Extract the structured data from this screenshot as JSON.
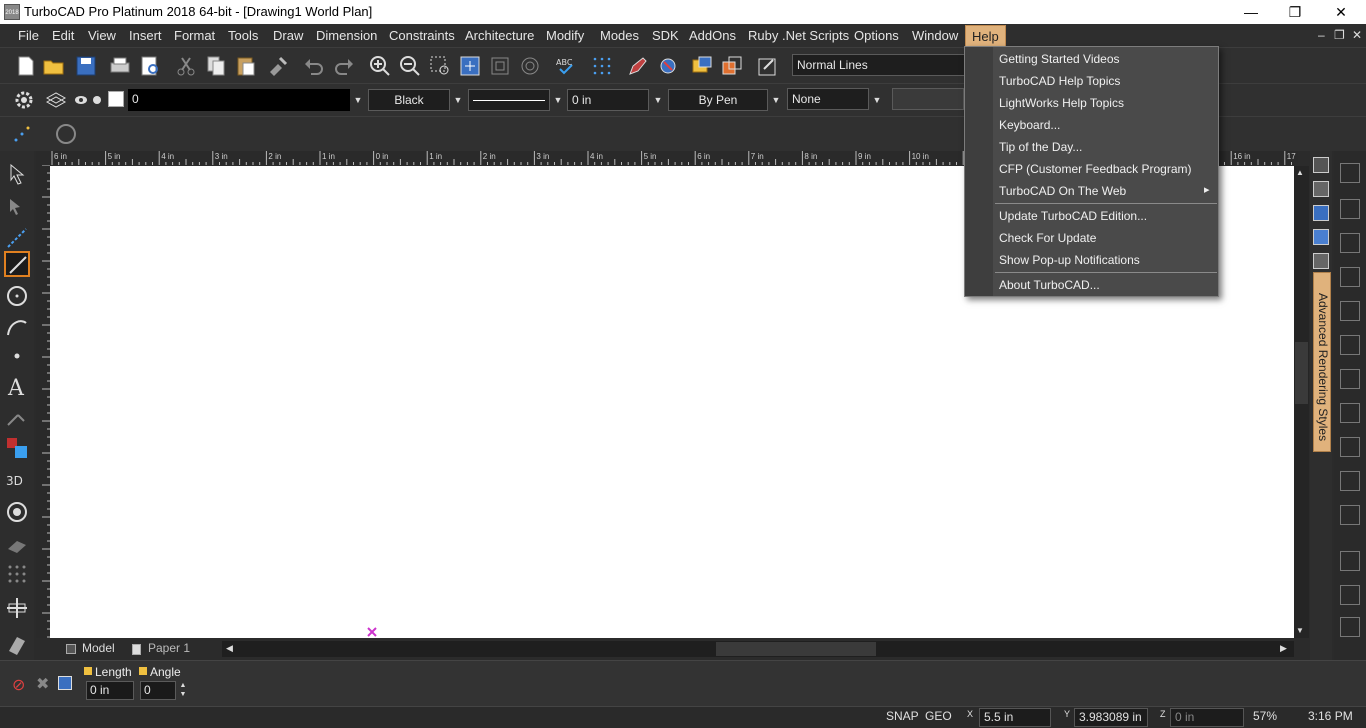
{
  "window": {
    "title": "TurboCAD Pro Platinum 2018 64-bit - [Drawing1 World Plan]",
    "app_icon_text": "2018",
    "minimize": "—",
    "maximize": "❐",
    "close": "✕"
  },
  "menubar": {
    "items": [
      "File",
      "Edit",
      "View",
      "Insert",
      "Format",
      "Tools",
      "Draw",
      "Dimension",
      "Constraints",
      "Architecture",
      "Modify",
      "Modes",
      "SDK",
      "AddOns",
      "Ruby .Net Scripts",
      "Options",
      "Window",
      "Help"
    ],
    "active": "Help",
    "mdi_controls": [
      "–",
      "❐",
      "✕"
    ]
  },
  "toolbar1": {
    "line_style": "Normal Lines"
  },
  "toolbar2": {
    "layer": "0",
    "color": "Black",
    "line_width": "0 in",
    "pen": "By Pen",
    "fill": "None"
  },
  "ruler": {
    "labels": [
      "6 in",
      "5 in",
      "4 in",
      "3 in",
      "2 in",
      "1 in",
      "0 in",
      "1 in",
      "2 in",
      "3 in",
      "4 in",
      "5 in",
      "6 in",
      "7 in",
      "8 in",
      "9 in",
      "10 in",
      "11 in",
      "12 in",
      "13 in",
      "14 in",
      "15 in",
      "16 in",
      "17"
    ]
  },
  "tabs": {
    "model": "Model",
    "paper": "Paper 1"
  },
  "side_panel": {
    "tab_label": "Advanced Rendering Styles"
  },
  "inspector": {
    "length_label": "Length",
    "length_value": "0 in",
    "angle_label": "Angle",
    "angle_value": "0"
  },
  "statusbar": {
    "snap": "SNAP",
    "geo": "GEO",
    "x_label": "X",
    "x_value": "5.5 in",
    "y_label": "Y",
    "y_value": "3.983089 in",
    "z_label": "Z",
    "z_value": "0 in",
    "zoom": "57%",
    "time": "3:16 PM"
  },
  "help_menu": {
    "items": [
      {
        "label": "Getting Started Videos"
      },
      {
        "label": "TurboCAD Help Topics"
      },
      {
        "label": "LightWorks Help Topics"
      },
      {
        "label": "Keyboard..."
      },
      {
        "label": "Tip of the Day..."
      },
      {
        "label": "CFP (Customer Feedback Program)"
      },
      {
        "label": "TurboCAD On The Web",
        "submenu": true
      },
      {
        "label": "Update TurboCAD Edition..."
      },
      {
        "label": "Check For Update"
      },
      {
        "label": "Show Pop-up Notifications"
      },
      {
        "label": "About TurboCAD..."
      }
    ],
    "submenu_arrow": "▸"
  },
  "colors": {
    "accent": "#e0b27c",
    "canvas": "#ffffff",
    "chrome": "#2e2e2e",
    "marker": "#cc33cc"
  }
}
